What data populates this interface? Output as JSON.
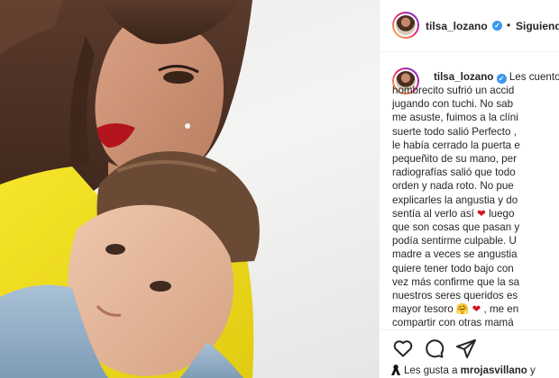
{
  "post": {
    "image_alt": "",
    "author": {
      "username": "tilsa_lozano",
      "verified": true,
      "separator": "•",
      "follow_status": "Siguiendo"
    },
    "caption": {
      "username": "tilsa_lozano",
      "lines": [
        "Les cuento",
        "hombrecito sufrió un accid",
        "jugando con tuchi. No sab",
        "me asuste, fuimos a la clíni",
        "suerte todo salió Perfecto ,",
        "le había cerrado la puerta e",
        "pequeñito de su mano, per",
        "radiografías salió que todo",
        "orden y nada roto. No pue",
        "explicarles la angustia y do",
        "sentía al verlo así",
        "luego",
        "que son cosas que pasan y",
        "podía sentirme culpable. U",
        "madre a veces se angustia",
        "quiere tener todo bajo con",
        "vez más confirme que la sa",
        "nuestros seres queridos es",
        "mayor tesoro",
        ", me en",
        "compartir con otras mamá"
      ],
      "emoji_heart": "❤",
      "emoji_hug": "🤗"
    },
    "actions": {
      "like_icon": "heart-outline-icon",
      "comment_icon": "comment-icon",
      "share_icon": "paper-plane-icon"
    },
    "likes": {
      "prefix": "Les gusta a",
      "user": "mrojasvillano",
      "suffix": "y"
    }
  },
  "colors": {
    "verified": "#3897f0",
    "heart": "#d4131f",
    "text": "#262626",
    "shirt": "#f3e11c"
  }
}
